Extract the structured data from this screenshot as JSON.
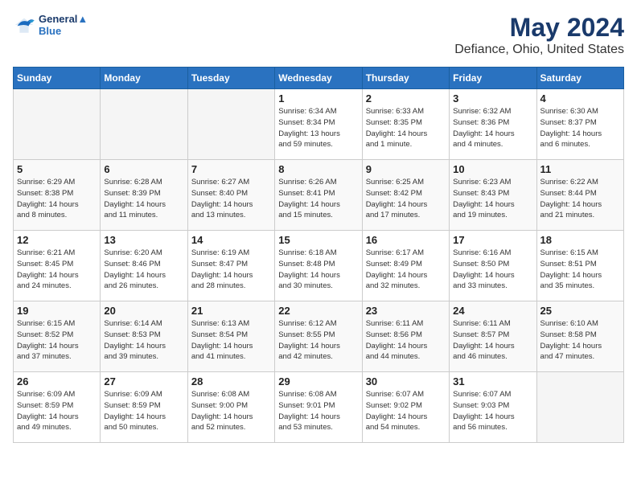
{
  "header": {
    "logo_line1": "General",
    "logo_line2": "Blue",
    "main_title": "May 2024",
    "sub_title": "Defiance, Ohio, United States"
  },
  "days_of_week": [
    "Sunday",
    "Monday",
    "Tuesday",
    "Wednesday",
    "Thursday",
    "Friday",
    "Saturday"
  ],
  "weeks": [
    [
      {
        "day": "",
        "info": ""
      },
      {
        "day": "",
        "info": ""
      },
      {
        "day": "",
        "info": ""
      },
      {
        "day": "1",
        "info": "Sunrise: 6:34 AM\nSunset: 8:34 PM\nDaylight: 13 hours\nand 59 minutes."
      },
      {
        "day": "2",
        "info": "Sunrise: 6:33 AM\nSunset: 8:35 PM\nDaylight: 14 hours\nand 1 minute."
      },
      {
        "day": "3",
        "info": "Sunrise: 6:32 AM\nSunset: 8:36 PM\nDaylight: 14 hours\nand 4 minutes."
      },
      {
        "day": "4",
        "info": "Sunrise: 6:30 AM\nSunset: 8:37 PM\nDaylight: 14 hours\nand 6 minutes."
      }
    ],
    [
      {
        "day": "5",
        "info": "Sunrise: 6:29 AM\nSunset: 8:38 PM\nDaylight: 14 hours\nand 8 minutes."
      },
      {
        "day": "6",
        "info": "Sunrise: 6:28 AM\nSunset: 8:39 PM\nDaylight: 14 hours\nand 11 minutes."
      },
      {
        "day": "7",
        "info": "Sunrise: 6:27 AM\nSunset: 8:40 PM\nDaylight: 14 hours\nand 13 minutes."
      },
      {
        "day": "8",
        "info": "Sunrise: 6:26 AM\nSunset: 8:41 PM\nDaylight: 14 hours\nand 15 minutes."
      },
      {
        "day": "9",
        "info": "Sunrise: 6:25 AM\nSunset: 8:42 PM\nDaylight: 14 hours\nand 17 minutes."
      },
      {
        "day": "10",
        "info": "Sunrise: 6:23 AM\nSunset: 8:43 PM\nDaylight: 14 hours\nand 19 minutes."
      },
      {
        "day": "11",
        "info": "Sunrise: 6:22 AM\nSunset: 8:44 PM\nDaylight: 14 hours\nand 21 minutes."
      }
    ],
    [
      {
        "day": "12",
        "info": "Sunrise: 6:21 AM\nSunset: 8:45 PM\nDaylight: 14 hours\nand 24 minutes."
      },
      {
        "day": "13",
        "info": "Sunrise: 6:20 AM\nSunset: 8:46 PM\nDaylight: 14 hours\nand 26 minutes."
      },
      {
        "day": "14",
        "info": "Sunrise: 6:19 AM\nSunset: 8:47 PM\nDaylight: 14 hours\nand 28 minutes."
      },
      {
        "day": "15",
        "info": "Sunrise: 6:18 AM\nSunset: 8:48 PM\nDaylight: 14 hours\nand 30 minutes."
      },
      {
        "day": "16",
        "info": "Sunrise: 6:17 AM\nSunset: 8:49 PM\nDaylight: 14 hours\nand 32 minutes."
      },
      {
        "day": "17",
        "info": "Sunrise: 6:16 AM\nSunset: 8:50 PM\nDaylight: 14 hours\nand 33 minutes."
      },
      {
        "day": "18",
        "info": "Sunrise: 6:15 AM\nSunset: 8:51 PM\nDaylight: 14 hours\nand 35 minutes."
      }
    ],
    [
      {
        "day": "19",
        "info": "Sunrise: 6:15 AM\nSunset: 8:52 PM\nDaylight: 14 hours\nand 37 minutes."
      },
      {
        "day": "20",
        "info": "Sunrise: 6:14 AM\nSunset: 8:53 PM\nDaylight: 14 hours\nand 39 minutes."
      },
      {
        "day": "21",
        "info": "Sunrise: 6:13 AM\nSunset: 8:54 PM\nDaylight: 14 hours\nand 41 minutes."
      },
      {
        "day": "22",
        "info": "Sunrise: 6:12 AM\nSunset: 8:55 PM\nDaylight: 14 hours\nand 42 minutes."
      },
      {
        "day": "23",
        "info": "Sunrise: 6:11 AM\nSunset: 8:56 PM\nDaylight: 14 hours\nand 44 minutes."
      },
      {
        "day": "24",
        "info": "Sunrise: 6:11 AM\nSunset: 8:57 PM\nDaylight: 14 hours\nand 46 minutes."
      },
      {
        "day": "25",
        "info": "Sunrise: 6:10 AM\nSunset: 8:58 PM\nDaylight: 14 hours\nand 47 minutes."
      }
    ],
    [
      {
        "day": "26",
        "info": "Sunrise: 6:09 AM\nSunset: 8:59 PM\nDaylight: 14 hours\nand 49 minutes."
      },
      {
        "day": "27",
        "info": "Sunrise: 6:09 AM\nSunset: 8:59 PM\nDaylight: 14 hours\nand 50 minutes."
      },
      {
        "day": "28",
        "info": "Sunrise: 6:08 AM\nSunset: 9:00 PM\nDaylight: 14 hours\nand 52 minutes."
      },
      {
        "day": "29",
        "info": "Sunrise: 6:08 AM\nSunset: 9:01 PM\nDaylight: 14 hours\nand 53 minutes."
      },
      {
        "day": "30",
        "info": "Sunrise: 6:07 AM\nSunset: 9:02 PM\nDaylight: 14 hours\nand 54 minutes."
      },
      {
        "day": "31",
        "info": "Sunrise: 6:07 AM\nSunset: 9:03 PM\nDaylight: 14 hours\nand 56 minutes."
      },
      {
        "day": "",
        "info": ""
      }
    ]
  ]
}
